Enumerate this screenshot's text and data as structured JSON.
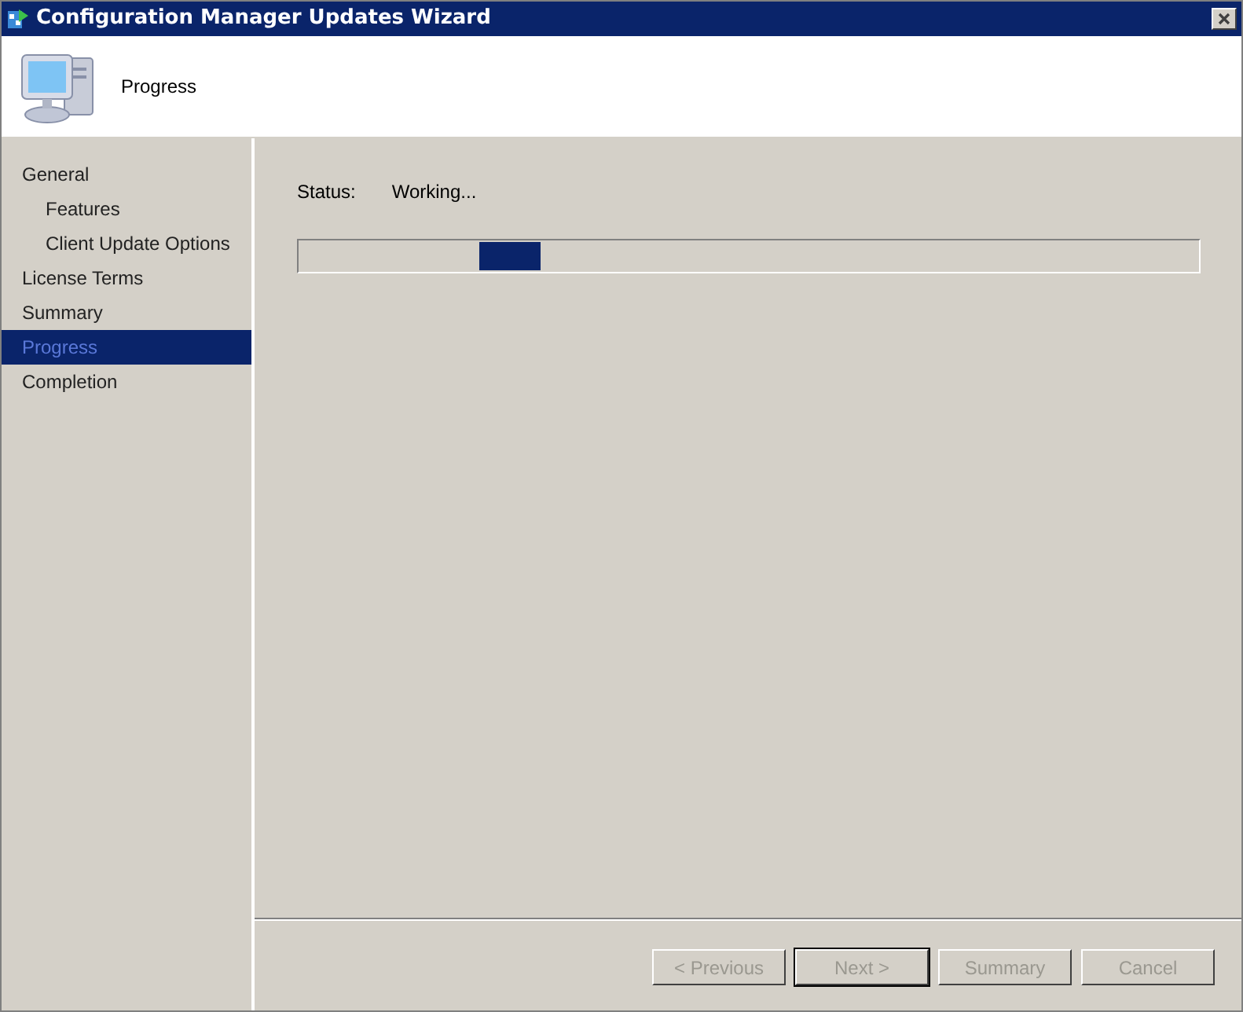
{
  "window": {
    "title": "Configuration Manager Updates Wizard"
  },
  "header": {
    "title": "Progress"
  },
  "sidebar": {
    "items": [
      {
        "label": "General",
        "selected": false
      },
      {
        "label": "Features",
        "selected": false,
        "indent": true
      },
      {
        "label": "Client Update Options",
        "selected": false,
        "indent": true
      },
      {
        "label": "License Terms",
        "selected": false
      },
      {
        "label": "Summary",
        "selected": false
      },
      {
        "label": "Progress",
        "selected": true
      },
      {
        "label": "Completion",
        "selected": false
      }
    ]
  },
  "status": {
    "label": "Status:",
    "value": "Working..."
  },
  "progress": {
    "level": 0.2
  },
  "buttons": [
    {
      "label": "< Previous",
      "disabled": true,
      "default": false
    },
    {
      "label": "Next >",
      "disabled": true,
      "default": true
    },
    {
      "label": "Summary",
      "disabled": true,
      "default": false
    },
    {
      "label": "Cancel",
      "disabled": true,
      "default": false
    }
  ]
}
